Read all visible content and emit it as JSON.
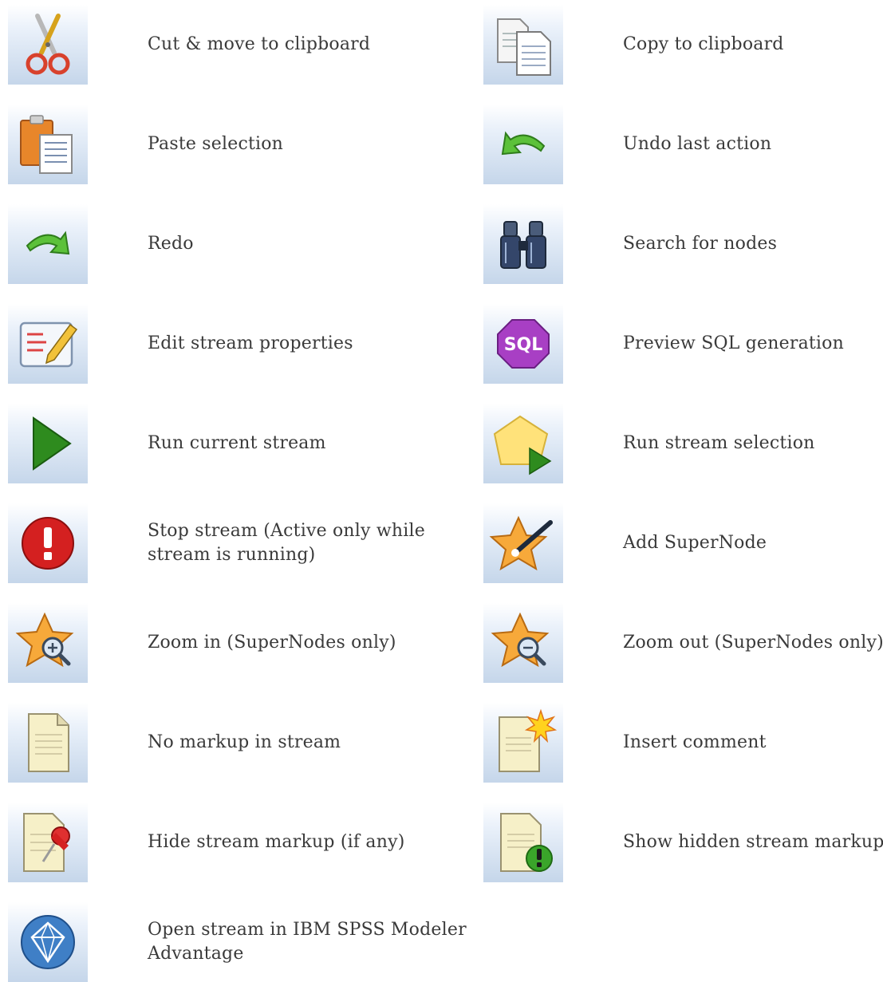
{
  "toolbar_legend": {
    "left": [
      {
        "icon": "scissors-icon",
        "label": "Cut & move to clipboard"
      },
      {
        "icon": "clipboard-paste-icon",
        "label": "Paste selection"
      },
      {
        "icon": "redo-arrow-icon",
        "label": "Redo"
      },
      {
        "icon": "edit-properties-icon",
        "label": "Edit stream properties"
      },
      {
        "icon": "run-triangle-icon",
        "label": "Run current stream"
      },
      {
        "icon": "stop-exclamation-icon",
        "label": "Stop stream (Active only while stream is running)"
      },
      {
        "icon": "zoom-in-star-icon",
        "label": "Zoom in (SuperNodes only)"
      },
      {
        "icon": "blank-document-icon",
        "label": "No markup in stream"
      },
      {
        "icon": "document-pushpin-icon",
        "label": "Hide stream markup (if any)"
      },
      {
        "icon": "diamond-globe-icon",
        "label": "Open stream in IBM SPSS Modeler Advantage"
      }
    ],
    "right": [
      {
        "icon": "copy-documents-icon",
        "label": "Copy to clipboard"
      },
      {
        "icon": "undo-arrow-icon",
        "label": "Undo last action"
      },
      {
        "icon": "binoculars-icon",
        "label": "Search for nodes"
      },
      {
        "icon": "sql-badge-icon",
        "label": "Preview SQL generation",
        "badge_text": "SQL"
      },
      {
        "icon": "run-selection-icon",
        "label": "Run stream selection"
      },
      {
        "icon": "supernode-star-wand-icon",
        "label": "Add SuperNode"
      },
      {
        "icon": "zoom-out-star-icon",
        "label": "Zoom out (SuperNodes only)"
      },
      {
        "icon": "insert-comment-icon",
        "label": "Insert comment"
      },
      {
        "icon": "show-markup-icon",
        "label": "Show hidden stream markup"
      }
    ]
  },
  "colors": {
    "tile_top": "#ffffff",
    "tile_bottom": "#c5d6ea",
    "label_text": "#3a3a3a",
    "sql_purple": "#a83fc4",
    "run_green": "#2e8b1e",
    "stop_red": "#d42020",
    "star_orange": "#f7a93a"
  }
}
